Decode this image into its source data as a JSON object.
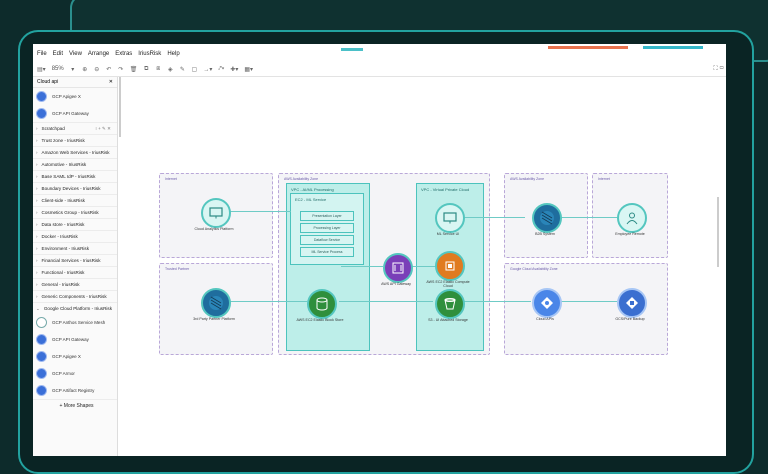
{
  "menu": [
    "File",
    "Edit",
    "View",
    "Arrange",
    "Extras",
    "IriusRisk",
    "Help"
  ],
  "toolbar": {
    "zoom": "85%"
  },
  "sidebar": {
    "search_title": "Cloud api",
    "close": "✕",
    "top_shapes": [
      "GCP Apigee X",
      "GCP API Gateway"
    ],
    "scratchpad": "Scratchpad",
    "categories": [
      "Trust zone - IriusRisk",
      "Amazon Web Services - IriusRisk",
      "Automotive - IriusRisk",
      "Base SAML IdP - IriusRisk",
      "Boundary Devices - IriusRisk",
      "Client-side - IriusRisk",
      "Cosmetics Group - IriusRisk",
      "Data store - IriusRisk",
      "Docker - IriusRisk",
      "Environment - IriusRisk",
      "Financial Services - IriusRisk",
      "Functional - IriusRisk",
      "General - IriusRisk",
      "Generic Components - IriusRisk",
      "Google Cloud Platform - IriusRisk"
    ],
    "gcp_shapes": [
      "GCP Anthos Service Mesh",
      "GCP API Gateway",
      "GCP Apigee X",
      "GCP Armor",
      "GCP Artifact Registry"
    ],
    "more_shapes": "+ More Shapes"
  },
  "diagram": {
    "zones": [
      "Internet",
      "Trusted Partner",
      "AWS Availability Zone",
      "AWS Availability Zone",
      "Internet",
      "Google Cloud Availability Zone"
    ],
    "vpcs": [
      "VPC - AI/ML Processing",
      "EC2 - ML Service",
      "VPC - Virtual Private Cloud"
    ],
    "services": [
      "Presentation Layer",
      "Processing Layer",
      "Dataflow Service",
      "ML Service Process"
    ],
    "nodes": {
      "cloud_analytics": "Cloud Analytics Platform",
      "partner": "3rd Party Partner Platform",
      "ebs": "AWS EC2 Elastic Block Store",
      "api_gw": "AWS API Gateway",
      "ml_ui": "ML Service UI",
      "ec2": "AWS EC2 Elastic Compute Cloud",
      "s3": "S3 - UI Attached Storage",
      "b2b": "B2B System",
      "employee": "Employee Remote",
      "cloud_apis": "Cloud APIs",
      "gcs": "GCS/Pure Backup"
    }
  }
}
